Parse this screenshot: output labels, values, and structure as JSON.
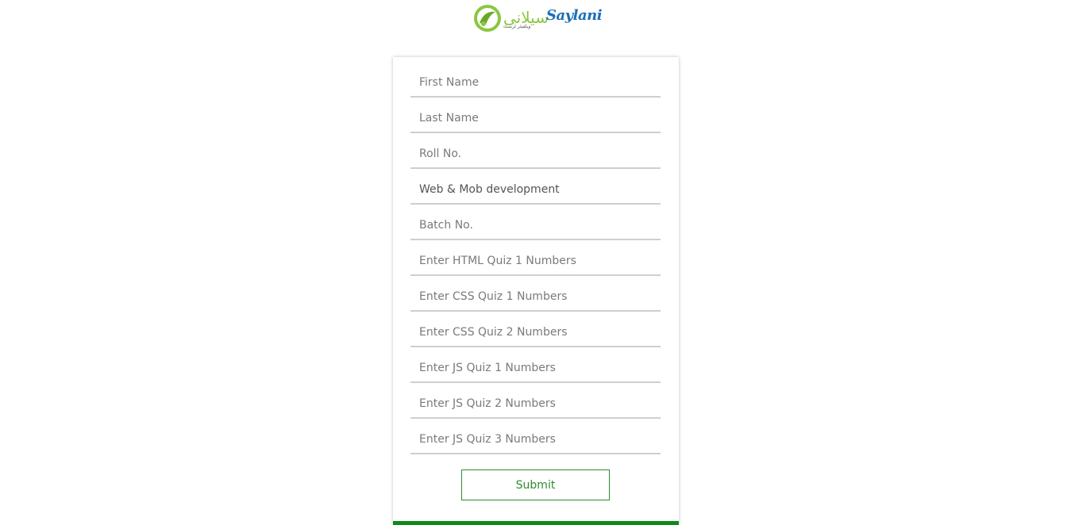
{
  "logo": {
    "brand_text": "Saylani",
    "urdu_text": "سیلانی",
    "sub_text": "ویلفیئر ٹرسٹ"
  },
  "form": {
    "fields": [
      {
        "placeholder": "First Name",
        "value": ""
      },
      {
        "placeholder": "Last Name",
        "value": ""
      },
      {
        "placeholder": "Roll No.",
        "value": ""
      },
      {
        "placeholder": "",
        "value": "Web & Mob development"
      },
      {
        "placeholder": "Batch No.",
        "value": ""
      },
      {
        "placeholder": "Enter HTML Quiz 1 Numbers",
        "value": ""
      },
      {
        "placeholder": "Enter CSS Quiz 1 Numbers",
        "value": ""
      },
      {
        "placeholder": "Enter CSS Quiz 2 Numbers",
        "value": ""
      },
      {
        "placeholder": "Enter JS Quiz 1 Numbers",
        "value": ""
      },
      {
        "placeholder": "Enter JS Quiz 2 Numbers",
        "value": ""
      },
      {
        "placeholder": "Enter JS Quiz 3 Numbers",
        "value": ""
      }
    ],
    "submit_label": "Submit"
  },
  "colors": {
    "accent_green": "#0c8a1a",
    "button_green": "#2e8b2e",
    "logo_blue": "#1b6fb6",
    "logo_green": "#8cc63f"
  }
}
